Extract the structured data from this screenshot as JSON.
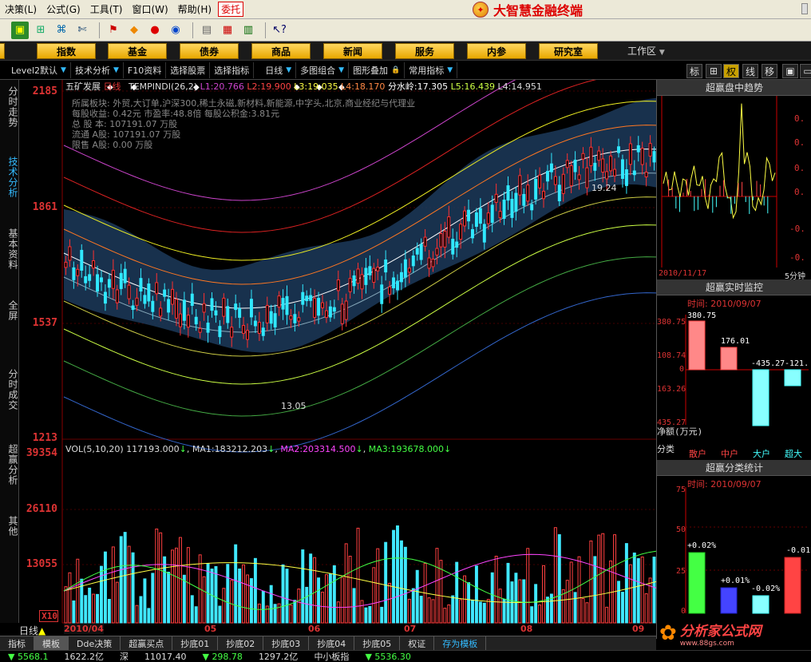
{
  "menu": {
    "items": [
      "决策(L)",
      "公式(G)",
      "工具(T)",
      "窗口(W)",
      "帮助(H)"
    ],
    "hot": "委托",
    "brand": "大智慧金融终端"
  },
  "toolbar": {
    "icons": [
      "window-icon",
      "grid-icon",
      "binoculars-icon",
      "tools-icon",
      "flag-icon",
      "diamond-icon",
      "circle-icon",
      "money-icon",
      "print-icon",
      "table-icon",
      "book-icon",
      "help-cursor-icon"
    ]
  },
  "nav": {
    "buttons": [
      "股",
      "指数",
      "基金",
      "债券",
      "商品",
      "新闻",
      "服务",
      "内参",
      "研究室"
    ],
    "workarea": "工作区"
  },
  "subbar": {
    "buttons": [
      "Level2默认",
      "技术分析",
      "F10资料",
      "选择股票",
      "选择指标",
      "日线",
      "多图组合",
      "图形叠加",
      "常用指标"
    ],
    "right_tabs": [
      "标",
      "权",
      "线",
      "移"
    ]
  },
  "left_tabs": [
    "分时走势",
    "技术分析",
    "基本资料",
    "全屏",
    "分时成交",
    "超赢分析",
    "其他"
  ],
  "stock": {
    "name": "五矿发展",
    "period": "日线",
    "indicator": "TEMPINDI(26,2)",
    "levels": [
      {
        "label": "L1:",
        "value": "20.766"
      },
      {
        "label": "L2:",
        "value": "19.900"
      },
      {
        "label": "L3:",
        "value": "19.035"
      },
      {
        "label": "L4:",
        "value": "18.170"
      },
      {
        "label": "分水岭:",
        "value": "17.305"
      },
      {
        "label": "L5:",
        "value": "16.439"
      },
      {
        "label": "L4:",
        "value": "14.951"
      }
    ],
    "info": [
      "所属板块: 外贸,大订单,沪深300,稀土永磁,新材料,新能源,中字头,北京,商业经纪与代理业",
      "每股收益: 0.42元   市盈率:48.8倍   每股公积金:3.81元",
      "总 股 本: 107191.07 万股",
      "流通 A股: 107191.07 万股",
      "限售 A股: 0.00  万股"
    ],
    "high_label": "19.24",
    "low_label": "13.05"
  },
  "price_axis": [
    "2185",
    "1861",
    "1537",
    "1213"
  ],
  "volume": {
    "header_label": "VOL(5,10,20)",
    "vol": "117193.000",
    "ma1_label": "MA1:",
    "ma1": "183212.203",
    "ma2_label": "MA2:",
    "ma2": "203314.500",
    "ma3_label": "MA3:",
    "ma3": "193678.000",
    "axis": [
      "39354",
      "26110",
      "13055"
    ],
    "unit": "X10"
  },
  "date_axis": [
    "2010/04",
    "05",
    "06",
    "07",
    "08",
    "09"
  ],
  "period_label": "日线",
  "right_panel": {
    "trend_title": "超赢盘中趋势",
    "trend_date": "2010/11/17",
    "trend_period": "5分钟",
    "trend_axis": [
      "0.",
      "0.",
      "0.",
      "0.",
      "0.",
      "-0.",
      "-0.",
      "-0."
    ],
    "monitor_title": "超赢实时监控",
    "monitor_time": "时间: 2010/09/07",
    "monitor_axis": [
      "380.75",
      "108.74",
      "0",
      "163.26",
      "435.27"
    ],
    "monitor_values": [
      "380.75",
      "176.01",
      "-435.27",
      "-121."
    ],
    "net_label": "净额(万元)",
    "classes_label": "分类",
    "classes": [
      "散户",
      "中户",
      "大户",
      "超大"
    ],
    "stats_title": "超赢分类统计",
    "stats_time": "时间: 2010/09/07",
    "stats_axis": [
      "75",
      "50",
      "25",
      "0"
    ],
    "stats_values": [
      "+0.02%",
      "+0.01%",
      "-0.02%",
      "-0.01"
    ]
  },
  "bottom_tabs": [
    "指标",
    "模板",
    "Dde决策",
    "超赢买点",
    "抄底01",
    "抄底02",
    "抄底03",
    "抄底04",
    "抄底05",
    "权证",
    "存为模板"
  ],
  "status": [
    "5568.1",
    "1622.2亿",
    "深",
    "11017.40",
    "298.78",
    "1297.2亿",
    "中小板指",
    "5536.30"
  ],
  "watermark": "分析家公式网",
  "watermark_url": "www.88gs.com",
  "colors": {
    "up": "#ff3030",
    "down": "#30e8ff",
    "accent": "#ffd700"
  }
}
